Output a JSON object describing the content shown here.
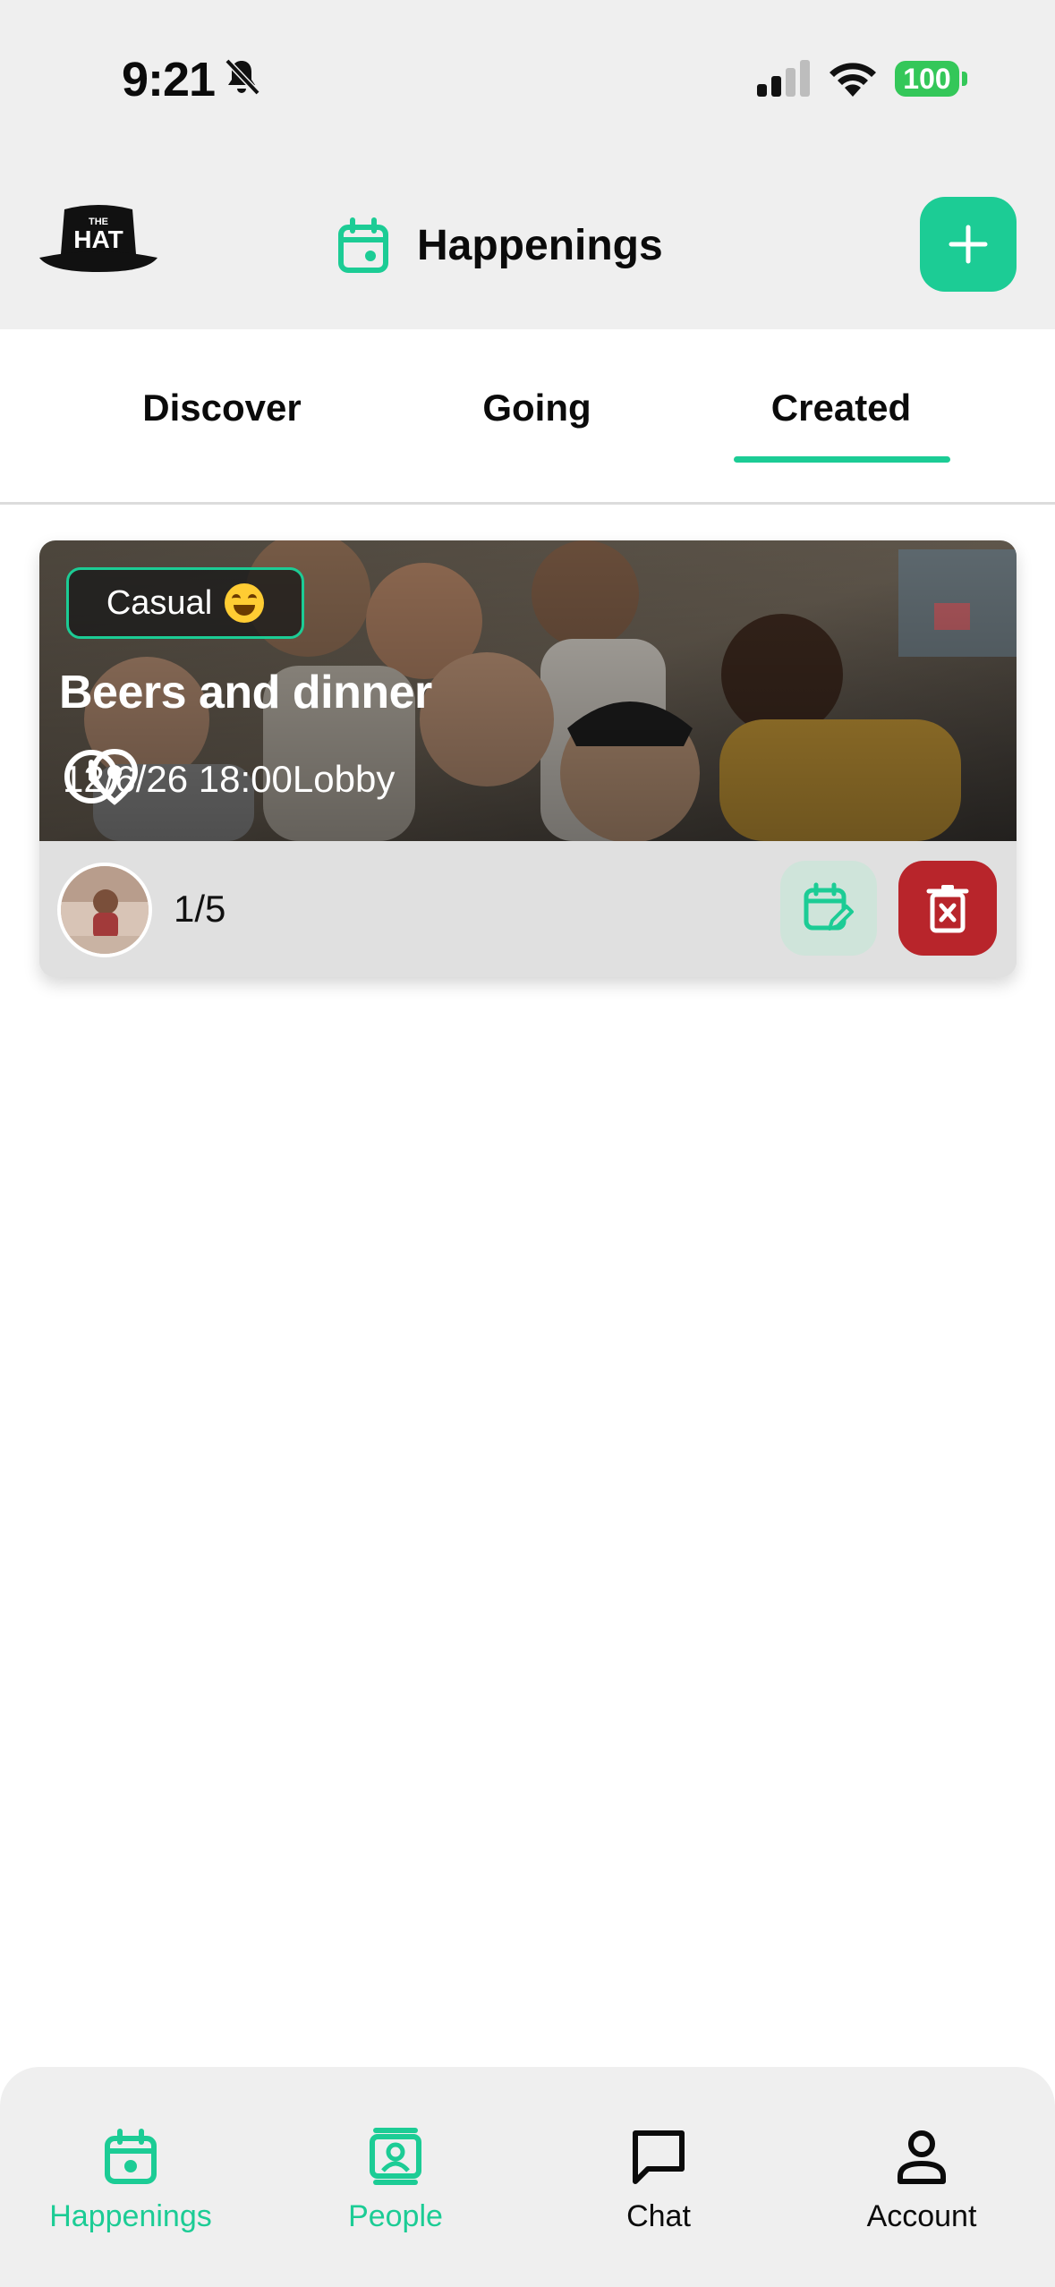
{
  "status_bar": {
    "time": "9:21",
    "battery": "100",
    "icons": [
      "bell-slash-icon",
      "cellular-signal-icon",
      "wifi-icon",
      "battery-icon"
    ]
  },
  "header": {
    "logo_text_small": "THE",
    "logo_text_big": "HAT",
    "title": "Happenings",
    "title_icon": "calendar-icon",
    "add_icon": "plus-icon"
  },
  "tabs": [
    {
      "label": "Discover",
      "selected": false
    },
    {
      "label": "Going",
      "selected": false
    },
    {
      "label": "Created",
      "selected": true
    }
  ],
  "event": {
    "vibe": "Casual",
    "vibe_emoji": "grinning-face-icon",
    "title": "Beers and dinner",
    "datetime": "12/6/26 18:00",
    "location": "Lobby",
    "attendees": "1/5",
    "edit_icon": "calendar-edit-icon",
    "delete_icon": "trash-x-icon"
  },
  "bottom_nav": [
    {
      "label": "Happenings",
      "icon": "calendar-icon",
      "active": true
    },
    {
      "label": "People",
      "icon": "contact-card-icon",
      "active": true
    },
    {
      "label": "Chat",
      "icon": "chat-bubble-icon",
      "active": false
    },
    {
      "label": "Account",
      "icon": "person-icon",
      "active": false
    }
  ],
  "colors": {
    "accent": "#1ccc95",
    "delete": "#b8252b",
    "header_bg": "#efefef",
    "card_footer_bg": "#e0e0e0"
  }
}
